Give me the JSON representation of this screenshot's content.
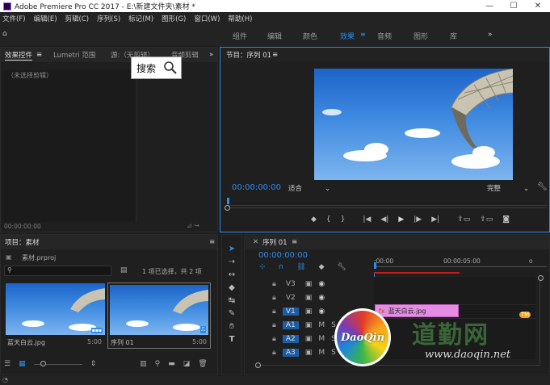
{
  "window": {
    "title": "Adobe Premiere Pro CC 2017 - E:\\新建文件夹\\素材 *"
  },
  "menu": [
    "文件(F)",
    "编辑(E)",
    "剪辑(C)",
    "序列(S)",
    "标记(M)",
    "图形(G)",
    "窗口(W)",
    "帮助(H)"
  ],
  "workspaces": {
    "items": [
      "组件",
      "编辑",
      "颜色",
      "效果",
      "音频",
      "图形",
      "库"
    ],
    "active": "效果",
    "more": "»"
  },
  "effect_controls": {
    "tabs": [
      "效果控件",
      "Lumetri 范围",
      "源:（无剪辑）",
      "音频剪辑"
    ],
    "empty_text": "（未选择剪辑）",
    "timecode": "00:00:00:00",
    "search_overlay": "搜索"
  },
  "program": {
    "title": "节目：序列 01",
    "timecode": "00:00:00:00",
    "fit": "适合",
    "quality": "完整"
  },
  "project": {
    "title": "项目：素材",
    "file": "素材.prproj",
    "count": "1 项已选择，共 2 项",
    "items": [
      {
        "name": "蓝天白云.jpg",
        "duration": "5:00"
      },
      {
        "name": "序列 01",
        "duration": "5:00"
      }
    ]
  },
  "timeline": {
    "tab": "序列 01",
    "timecode": "00:00:00:00",
    "ruler": [
      ":00:00",
      "00:00:05:00"
    ],
    "video_tracks": [
      "V3",
      "V2",
      "V1"
    ],
    "audio_tracks": [
      "A1",
      "A2",
      "A3"
    ],
    "clip": "蓝天白云.jpg"
  },
  "watermark": {
    "logo": "DaoQin",
    "text": "道勤网",
    "url": "www.daoqin.net",
    "tm": "TM"
  }
}
